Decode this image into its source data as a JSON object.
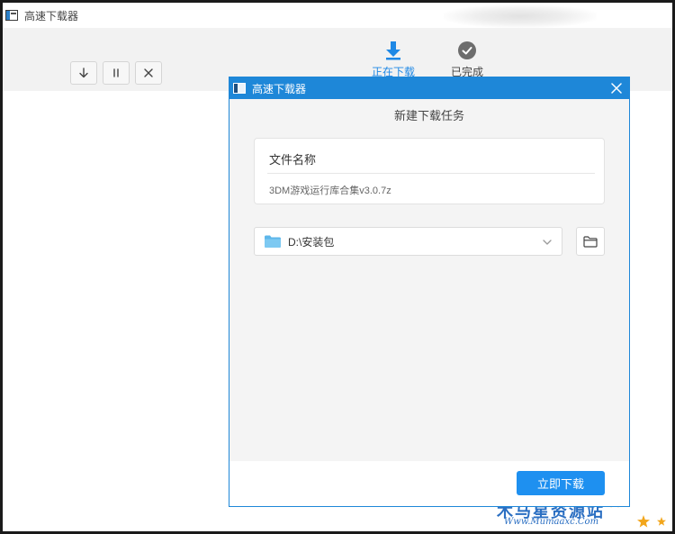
{
  "main_window": {
    "title": "高速下载器",
    "toolbar_buttons": [
      {
        "icon": "arrow-down-icon",
        "name": "download-button"
      },
      {
        "icon": "pause-icon",
        "name": "pause-button"
      },
      {
        "icon": "close-icon",
        "name": "delete-button"
      }
    ],
    "tabs": [
      {
        "label": "正在下载",
        "icon": "download-arrow-icon",
        "active": true
      },
      {
        "label": "已完成",
        "icon": "check-circle-icon",
        "active": false
      }
    ]
  },
  "dialog": {
    "title": "高速下载器",
    "subtitle": "新建下载任务",
    "file_card": {
      "heading": "文件名称",
      "value": "3DM游戏运行库合集v3.0.7z"
    },
    "path": {
      "value": "D:\\安装包",
      "icon": "folder-icon"
    },
    "browse_icon": "folder-outline-icon",
    "start_button": "立即下载"
  },
  "watermark": {
    "text": "木马星资源站",
    "url": "Www.Mumaaxc.Com"
  },
  "colors": {
    "accent": "#1e87d8",
    "button": "#1e90f0",
    "tab_active": "#1e88e5",
    "tab_inactive_icon": "#6d6d6d"
  }
}
